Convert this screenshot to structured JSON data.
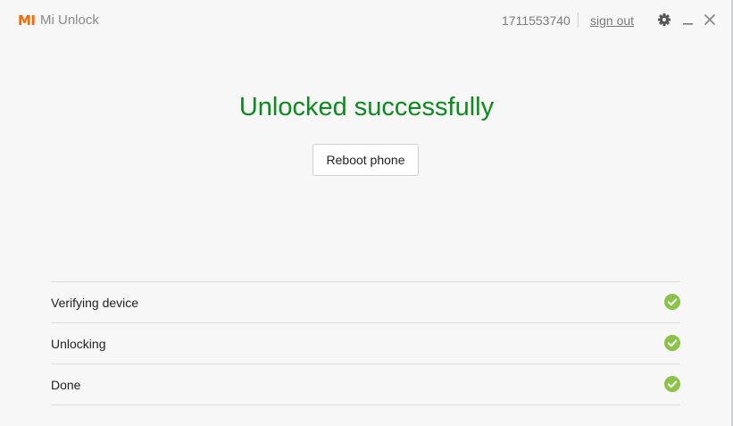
{
  "titlebar": {
    "logo_text": "MI",
    "app_title": "Mi Unlock",
    "account_id": "1711553740",
    "signout_label": "sign out",
    "icons": [
      "gear-icon",
      "minimize-icon",
      "close-icon"
    ]
  },
  "main": {
    "headline": "Unlocked successfully",
    "reboot_label": "Reboot phone"
  },
  "steps": [
    {
      "label": "Verifying device",
      "status": "done"
    },
    {
      "label": "Unlocking",
      "status": "done"
    },
    {
      "label": "Done",
      "status": "done"
    }
  ],
  "colors": {
    "brand": "#ff6700",
    "success": "#0c8a1e",
    "check": "#8bc34a"
  }
}
